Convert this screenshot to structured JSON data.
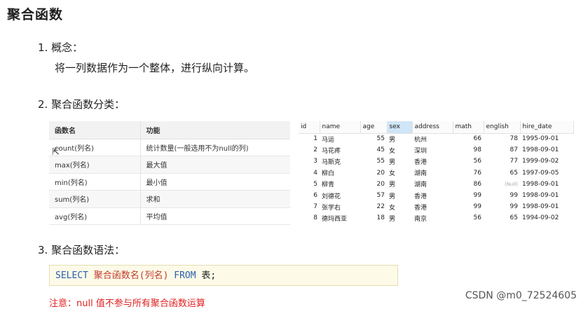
{
  "title": "聚合函数",
  "section1": {
    "heading": "1. 概念：",
    "desc": "将一列数据作为一个整体，进行纵向计算。"
  },
  "section2": {
    "heading": "2. 聚合函数分类："
  },
  "func_table": {
    "headers": [
      "函数名",
      "功能"
    ],
    "rows": [
      [
        "count(列名)",
        "统计数量(一般选用不为null的列)"
      ],
      [
        "max(列名)",
        "最大值"
      ],
      [
        "min(列名)",
        "最小值"
      ],
      [
        "sum(列名)",
        "求和"
      ],
      [
        "avg(列名)",
        "平均值"
      ]
    ]
  },
  "data_grid": {
    "headers": [
      "id",
      "name",
      "age",
      "sex",
      "address",
      "math",
      "english",
      "hire_date"
    ],
    "selected_column": "sex",
    "rows": [
      [
        "1",
        "马运",
        "55",
        "男",
        "杭州",
        "66",
        "78",
        "1995-09-01"
      ],
      [
        "2",
        "马花疼",
        "45",
        "女",
        "深圳",
        "98",
        "87",
        "1998-09-01"
      ],
      [
        "3",
        "马斯克",
        "55",
        "男",
        "香港",
        "56",
        "77",
        "1999-09-02"
      ],
      [
        "4",
        "柳白",
        "20",
        "女",
        "湖南",
        "76",
        "65",
        "1997-09-05"
      ],
      [
        "5",
        "柳青",
        "20",
        "男",
        "湖南",
        "86",
        "(Null)",
        "1998-09-01"
      ],
      [
        "6",
        "刘德花",
        "57",
        "男",
        "香港",
        "99",
        "99",
        "1998-09-01"
      ],
      [
        "7",
        "张学右",
        "22",
        "女",
        "香港",
        "99",
        "99",
        "1998-09-01"
      ],
      [
        "8",
        "德玛西亚",
        "18",
        "男",
        "南京",
        "56",
        "65",
        "1994-09-02"
      ]
    ]
  },
  "section3": {
    "heading": "3. 聚合函数语法："
  },
  "code": {
    "kw1": "SELECT",
    "fn": "聚合函数名(列名)",
    "kw2": "FROM",
    "tb": "表;"
  },
  "note": "注意：null 值不参与所有聚合函数运算",
  "watermark": "CSDN @m0_72524605",
  "colors": {
    "selected_header": "#cfe6f7",
    "note": "#e02020",
    "keyword": "#2a5db0",
    "function": "#c0392b",
    "code_bg": "#fdfbe8"
  }
}
